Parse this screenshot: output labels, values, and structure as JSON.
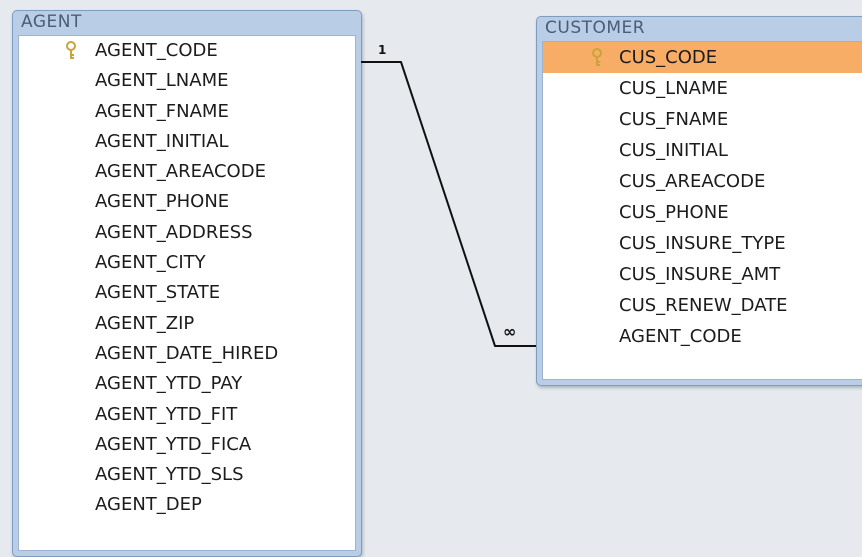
{
  "agent_table": {
    "title": "AGENT",
    "primary_key": "AGENT_CODE",
    "fields": [
      "AGENT_CODE",
      "AGENT_LNAME",
      "AGENT_FNAME",
      "AGENT_INITIAL",
      "AGENT_AREACODE",
      "AGENT_PHONE",
      "AGENT_ADDRESS",
      "AGENT_CITY",
      "AGENT_STATE",
      "AGENT_ZIP",
      "AGENT_DATE_HIRED",
      "AGENT_YTD_PAY",
      "AGENT_YTD_FIT",
      "AGENT_YTD_FICA",
      "AGENT_YTD_SLS",
      "AGENT_DEP"
    ]
  },
  "customer_table": {
    "title": "CUSTOMER",
    "primary_key": "CUS_CODE",
    "selected_field": "CUS_CODE",
    "fields": [
      "CUS_CODE",
      "CUS_LNAME",
      "CUS_FNAME",
      "CUS_INITIAL",
      "CUS_AREACODE",
      "CUS_PHONE",
      "CUS_INSURE_TYPE",
      "CUS_INSURE_AMT",
      "CUS_RENEW_DATE",
      "AGENT_CODE"
    ]
  },
  "relationship": {
    "from_table": "AGENT",
    "from_field": "AGENT_CODE",
    "to_table": "CUSTOMER",
    "to_field": "AGENT_CODE",
    "one_label": "1",
    "many_label": "∞"
  },
  "colors": {
    "background": "#e6eaee",
    "window_frame": "#b9cde6",
    "selected_row": "#f8ad66",
    "key_icon": "#c9a43a"
  },
  "icons": {
    "primary_key": "key-icon"
  }
}
